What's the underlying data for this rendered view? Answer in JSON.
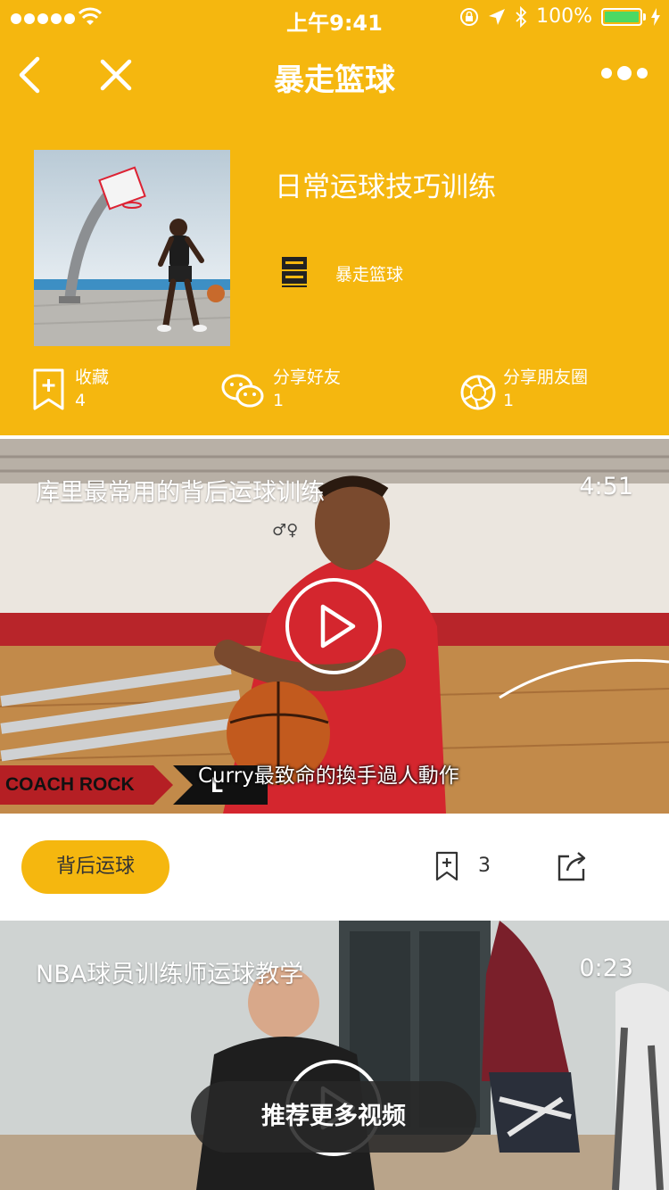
{
  "status_bar": {
    "time": "上午9:41",
    "battery": "100%"
  },
  "nav": {
    "title": "暴走篮球"
  },
  "album": {
    "title": "日常运球技巧训练",
    "author": "暴走篮球",
    "author_logo_text": "暴走篮球"
  },
  "actions": [
    {
      "label": "收藏",
      "count": "4",
      "icon": "bookmark-add-icon"
    },
    {
      "label": "分享好友",
      "count": "1",
      "icon": "wechat-icon"
    },
    {
      "label": "分享朋友圈",
      "count": "1",
      "icon": "moments-icon"
    }
  ],
  "videos": [
    {
      "title": "库里最常用的背后运球训练",
      "duration": "4:51",
      "subtitle": "Curry最致命的換手過人動作",
      "channel_label": "COACH ROCK",
      "tag": "背后运球",
      "bookmark_count": "3"
    },
    {
      "title": "NBA球员训练师运球教学",
      "duration": "0:23"
    }
  ],
  "toast": "推荐更多视频",
  "colors": {
    "brand": "#f5b70f",
    "text": "#333333"
  }
}
